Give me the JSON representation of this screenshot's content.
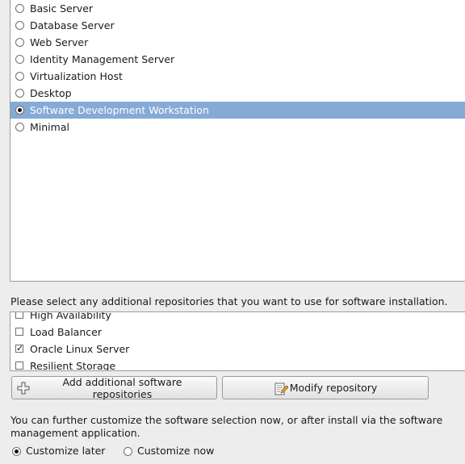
{
  "groups": [
    {
      "label": "Basic Server",
      "selected": false
    },
    {
      "label": "Database Server",
      "selected": false
    },
    {
      "label": "Web Server",
      "selected": false
    },
    {
      "label": "Identity Management Server",
      "selected": false
    },
    {
      "label": "Virtualization Host",
      "selected": false
    },
    {
      "label": "Desktop",
      "selected": false
    },
    {
      "label": "Software Development Workstation",
      "selected": true
    },
    {
      "label": "Minimal",
      "selected": false
    }
  ],
  "repo_prompt": "Please select any additional repositories that you want to use for software installation.",
  "repos": [
    {
      "label": "High Availability",
      "checked": false
    },
    {
      "label": "Load Balancer",
      "checked": false
    },
    {
      "label": "Oracle Linux Server",
      "checked": true
    },
    {
      "label": "Resilient Storage",
      "checked": false
    }
  ],
  "buttons": {
    "add": "Add additional software repositories",
    "modify": "Modify repository"
  },
  "customize_text": "You can further customize the software selection now, or after install via the software management application.",
  "customize_options": {
    "later": "Customize later",
    "now": "Customize now",
    "selected": "later"
  },
  "colors": {
    "selection": "#86aad6",
    "background": "#ededed"
  },
  "icons": {
    "add": "plus-icon",
    "modify": "edit-document-icon"
  }
}
